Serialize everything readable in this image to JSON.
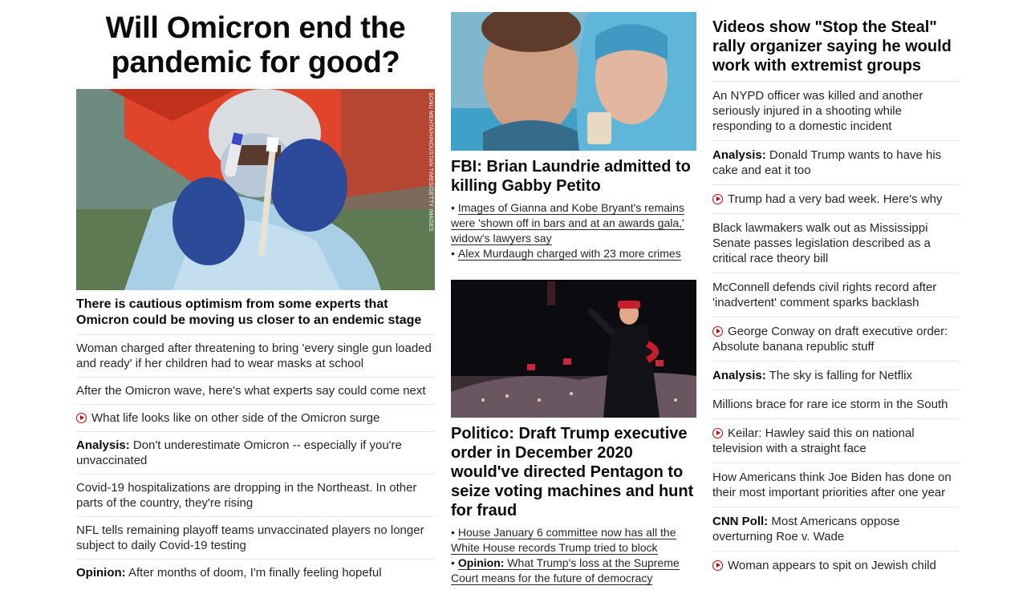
{
  "col1": {
    "hero_title": "Will Omicron end the pandemic for good?",
    "photo_credit": "SONU MEHTA/HINDUSTAN TIMES/GETTY IMAGES",
    "lead": "There is cautious optimism from some experts that Omicron could be moving us closer to an endemic stage",
    "items": [
      {
        "kicker": "",
        "video": false,
        "text": "Woman charged after threatening to bring 'every single gun loaded and ready' if her children had to wear masks at school"
      },
      {
        "kicker": "",
        "video": false,
        "text": "After the Omicron wave, here's what experts say could come next"
      },
      {
        "kicker": "",
        "video": true,
        "text": "What life looks like on other side of the Omicron surge"
      },
      {
        "kicker": "Analysis:",
        "video": false,
        "text": "Don't underestimate Omicron -- especially if you're unvaccinated"
      },
      {
        "kicker": "",
        "video": false,
        "text": "Covid-19 hospitalizations are dropping in the Northeast. In other parts of the country, they're rising"
      },
      {
        "kicker": "",
        "video": false,
        "text": "NFL tells remaining playoff teams unvaccinated players no longer subject to daily Covid-19 testing"
      },
      {
        "kicker": "Opinion:",
        "video": false,
        "text": "After months of doom, I'm finally feeling hopeful"
      }
    ]
  },
  "col2": {
    "story1": {
      "title": "FBI: Brian Laundrie admitted to killing Gabby Petito",
      "bullets": [
        {
          "kicker": "",
          "text": "Images of Gianna and Kobe Bryant's remains were 'shown off in bars and at an awards gala,' widow's lawyers say"
        },
        {
          "kicker": "",
          "text": "Alex Murdaugh charged with 23 more crimes"
        }
      ]
    },
    "story2": {
      "title": "Politico: Draft Trump executive order in December 2020 would've directed Pentagon to seize voting machines and hunt for fraud",
      "bullets": [
        {
          "kicker": "",
          "text": "House January 6 committee now has all the White House records Trump tried to block"
        },
        {
          "kicker": "Opinion:",
          "text": "What Trump's loss at the Supreme Court means for the future of democracy"
        }
      ]
    }
  },
  "col3": {
    "title": "Videos show \"Stop the Steal\" rally organizer saying he would work with extremist groups",
    "items": [
      {
        "kicker": "",
        "video": false,
        "text": "An NYPD officer was killed and another seriously injured in a shooting while responding to a domestic incident"
      },
      {
        "kicker": "Analysis:",
        "video": false,
        "text": "Donald Trump wants to have his cake and eat it too"
      },
      {
        "kicker": "",
        "video": true,
        "text": "Trump had a very bad week. Here's why"
      },
      {
        "kicker": "",
        "video": false,
        "text": "Black lawmakers walk out as Mississippi Senate passes legislation described as a critical race theory bill"
      },
      {
        "kicker": "",
        "video": false,
        "text": "McConnell defends civil rights record after 'inadvertent' comment sparks backlash"
      },
      {
        "kicker": "",
        "video": true,
        "text": "George Conway on draft executive order: Absolute banana republic stuff"
      },
      {
        "kicker": "Analysis:",
        "video": false,
        "text": "The sky is falling for Netflix"
      },
      {
        "kicker": "",
        "video": false,
        "text": "Millions brace for rare ice storm in the South"
      },
      {
        "kicker": "",
        "video": true,
        "text": "Keilar: Hawley said this on national television with a straight face"
      },
      {
        "kicker": "",
        "video": false,
        "text": "How Americans think Joe Biden has done on their most important priorities after one year"
      },
      {
        "kicker": "CNN Poll:",
        "video": false,
        "text": "Most Americans oppose overturning Roe v. Wade"
      },
      {
        "kicker": "",
        "video": true,
        "text": "Woman appears to spit on Jewish child"
      }
    ]
  },
  "colors": {
    "play_icon": "#cc0000",
    "divider": "#e6e6e6",
    "headline": "#0c0c0c"
  }
}
